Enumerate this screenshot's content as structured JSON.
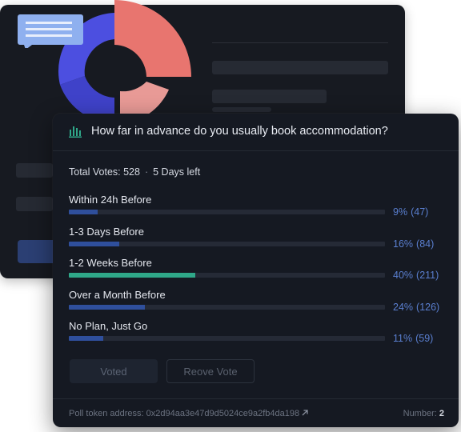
{
  "poll": {
    "title": "How far in advance do you usually book accommodation?",
    "total_votes": "Total Votes: 528",
    "time_left": "5 Days left",
    "options": [
      {
        "label": "Within 24h Before",
        "percent": "9%",
        "count": "(47)",
        "fill": 0.09,
        "selected": false
      },
      {
        "label": "1-3 Days Before",
        "percent": "16%",
        "count": "(84)",
        "fill": 0.16,
        "selected": false
      },
      {
        "label": "1-2 Weeks Before",
        "percent": "40%",
        "count": "(211)",
        "fill": 0.4,
        "selected": true
      },
      {
        "label": "Over a Month Before",
        "percent": "24%",
        "count": "(126)",
        "fill": 0.24,
        "selected": false
      },
      {
        "label": "No Plan, Just Go",
        "percent": "11%",
        "count": "(59)",
        "fill": 0.11,
        "selected": false
      }
    ],
    "buttons": {
      "voted": "Voted",
      "revote": "Reove Vote"
    },
    "footer": {
      "token_label": "Poll token address:",
      "token_address": "0x2d94aa3e47d9d5024ce9a2fb4da198",
      "number_label": "Number:",
      "number_value": "2"
    }
  },
  "colors": {
    "accent_blue": "#2f4f9c",
    "selected_green": "#2fa889",
    "result_text": "#5a7fd0"
  },
  "icons": {
    "poll": "bar-chart-icon",
    "token_link": "external-link-icon"
  }
}
